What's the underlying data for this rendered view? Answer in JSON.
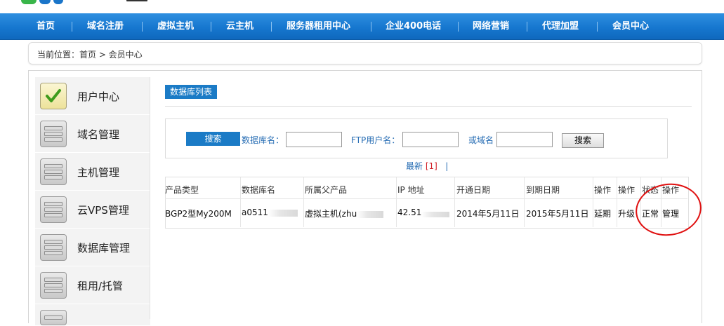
{
  "nav": {
    "items": [
      "首页",
      "域名注册",
      "虚拟主机",
      "云主机",
      "服务器租用中心",
      "企业400电话",
      "网络营销",
      "代理加盟",
      "会员中心"
    ]
  },
  "breadcrumb": {
    "text": "当前位置：首页 > 会员中心"
  },
  "sidebar": {
    "items": [
      {
        "label": "用户中心",
        "icon": "checkmark-icon"
      },
      {
        "label": "域名管理",
        "icon": "server-icon"
      },
      {
        "label": "主机管理",
        "icon": "server-icon"
      },
      {
        "label": "云VPS管理",
        "icon": "server-icon"
      },
      {
        "label": "数据库管理",
        "icon": "server-icon"
      },
      {
        "label": "租用/托管",
        "icon": "server-icon"
      }
    ]
  },
  "main": {
    "list_title": "数据库列表",
    "search": {
      "tag": "搜索",
      "db_name_label": "数据库名：",
      "db_name_value": "",
      "ftp_user_label": "FTP用户名：",
      "ftp_user_value": "",
      "domain_label": "或域名",
      "domain_value": "",
      "button": "搜索"
    },
    "pager": {
      "latest": "最新",
      "current": "[1]",
      "sep": "|"
    },
    "table": {
      "headers": [
        "产品类型",
        "数据库名",
        "所属父产品",
        "IP 地址",
        "开通日期",
        "到期日期",
        "操作",
        "操作",
        "状态",
        "操作"
      ],
      "row": {
        "type": "BGP2型My200M",
        "db_name": "a0511",
        "parent": "虚拟主机(zhu",
        "ip": "42.51",
        "open_date": "2014年5月11日",
        "expire_date": "2015年5月11日",
        "op_renew": "延期",
        "op_upgrade": "升级",
        "status": "正常",
        "op_manage": "管理"
      }
    }
  },
  "colors": {
    "nav": "#1677cf",
    "accent": "#1b7bc6",
    "highlight_circle": "#e01010"
  }
}
